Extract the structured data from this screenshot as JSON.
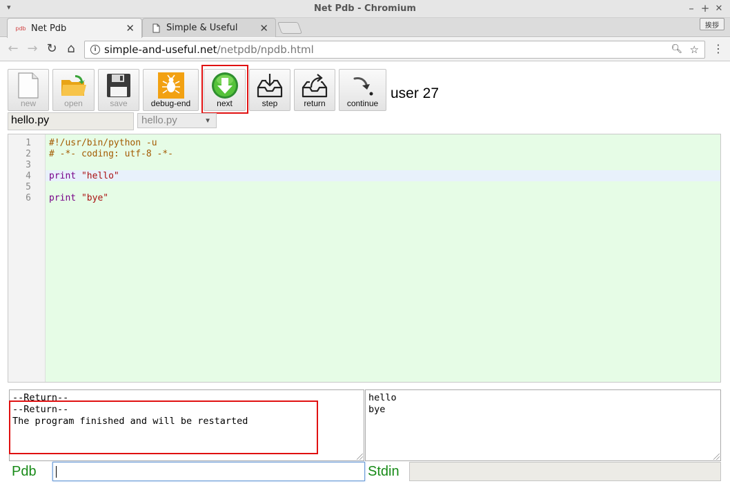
{
  "window": {
    "title": "Net Pdb - Chromium",
    "controls": {
      "minimize": "–",
      "maximize": "+",
      "close": "✕"
    }
  },
  "browser": {
    "tabs": [
      {
        "label": "Net Pdb",
        "favicon_text": "pdb",
        "active": true
      },
      {
        "label": "Simple & Useful",
        "active": false
      }
    ],
    "tab_close": "✕",
    "ime_button": "挨拶",
    "url_host": "simple-and-useful.net",
    "url_path": "/netpdb/npdb.html",
    "icons": {
      "back": "←",
      "forward": "→",
      "reload": "↻",
      "home": "⌂",
      "zoom": "🔍︎",
      "bookmark": "☆",
      "menu": "⋮"
    }
  },
  "toolbar": {
    "buttons": [
      {
        "id": "new",
        "label": "new",
        "enabled": false,
        "icon": "blank-file-icon"
      },
      {
        "id": "open",
        "label": "open",
        "enabled": false,
        "icon": "folder-open-icon"
      },
      {
        "id": "save",
        "label": "save",
        "enabled": false,
        "icon": "floppy-disk-icon"
      },
      {
        "id": "debug-end",
        "label": "debug-end",
        "enabled": true,
        "icon": "bug-icon"
      },
      {
        "id": "next",
        "label": "next",
        "enabled": true,
        "icon": "green-down-arrow-icon",
        "highlighted": true
      },
      {
        "id": "step",
        "label": "step",
        "enabled": true,
        "icon": "inbox-in-icon"
      },
      {
        "id": "return",
        "label": "return",
        "enabled": true,
        "icon": "inbox-out-icon"
      },
      {
        "id": "continue",
        "label": "continue",
        "enabled": true,
        "icon": "curved-arrow-icon"
      }
    ],
    "user_label": "user 27"
  },
  "file": {
    "name_value": "hello.py",
    "select_value": "hello.py",
    "select_arrow": "▼"
  },
  "editor": {
    "active_line": 4,
    "lines": [
      {
        "num": "1",
        "tokens": [
          {
            "text": "#!/usr/bin/python -u",
            "type": "comment"
          }
        ]
      },
      {
        "num": "2",
        "tokens": [
          {
            "text": "# -*- coding: utf-8 -*-",
            "type": "comment"
          }
        ]
      },
      {
        "num": "3",
        "tokens": []
      },
      {
        "num": "4",
        "tokens": [
          {
            "text": "print",
            "type": "kw"
          },
          {
            "text": " ",
            "type": "plain"
          },
          {
            "text": "\"hello\"",
            "type": "str"
          }
        ]
      },
      {
        "num": "5",
        "tokens": []
      },
      {
        "num": "6",
        "tokens": [
          {
            "text": "print",
            "type": "kw"
          },
          {
            "text": " ",
            "type": "plain"
          },
          {
            "text": "\"bye\"",
            "type": "str"
          }
        ]
      }
    ]
  },
  "pdb_output": {
    "text": "--Return--\n--Return--\nThe program finished and will be restarted"
  },
  "stdout_output": {
    "text": "hello\nbye"
  },
  "console": {
    "pdb_label": "Pdb",
    "pdb_input_value": "",
    "stdin_label": "Stdin",
    "stdin_input_value": ""
  },
  "colors": {
    "highlight": "#e01010",
    "editor_bg": "#e6fce6",
    "label_green": "#178a17"
  }
}
